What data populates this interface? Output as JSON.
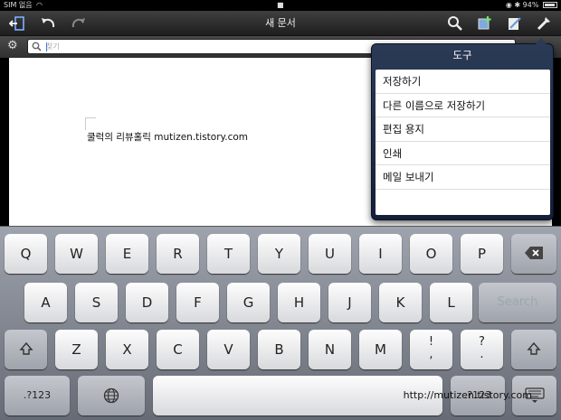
{
  "status": {
    "carrier": "SIM 없음",
    "battery": "94%",
    "battery_fill": 0.94
  },
  "nav": {
    "title": "새 문서"
  },
  "search": {
    "placeholder": "찾기",
    "value": ""
  },
  "document": {
    "text": "쿨럭의 리뷰홀릭 mutizen.tistory.com"
  },
  "popover": {
    "title": "도구",
    "items": [
      "저장하기",
      "다른 이름으로 저장하기",
      "편집 용지",
      "인쇄",
      "메일 보내기"
    ]
  },
  "keyboard": {
    "row1": [
      "Q",
      "W",
      "E",
      "R",
      "T",
      "Y",
      "U",
      "I",
      "O",
      "P"
    ],
    "row2": [
      "A",
      "S",
      "D",
      "F",
      "G",
      "H",
      "J",
      "K",
      "L"
    ],
    "row3": [
      "Z",
      "X",
      "C",
      "V",
      "B",
      "N",
      "M"
    ],
    "row3_punct": [
      [
        "!",
        ","
      ],
      [
        "?",
        "."
      ]
    ],
    "search_label": "Search",
    "numbers_label": ".?123",
    "numbers_label_right": ".?123"
  },
  "watermark": "http://mutizen.tistory.com",
  "colors": {
    "popover": "#1c2a46",
    "nav": "#2e2e2e",
    "keyboard": "#8a8f99",
    "caret": "#3b7bd8"
  },
  "icons": {
    "nav": [
      "exit-icon",
      "undo-icon",
      "redo-icon",
      "search-icon",
      "insert-icon",
      "pen-icon",
      "tools-icon"
    ],
    "keyboard": [
      "shift-icon",
      "delete-icon",
      "globe-icon",
      "hide-keyboard-icon"
    ]
  }
}
